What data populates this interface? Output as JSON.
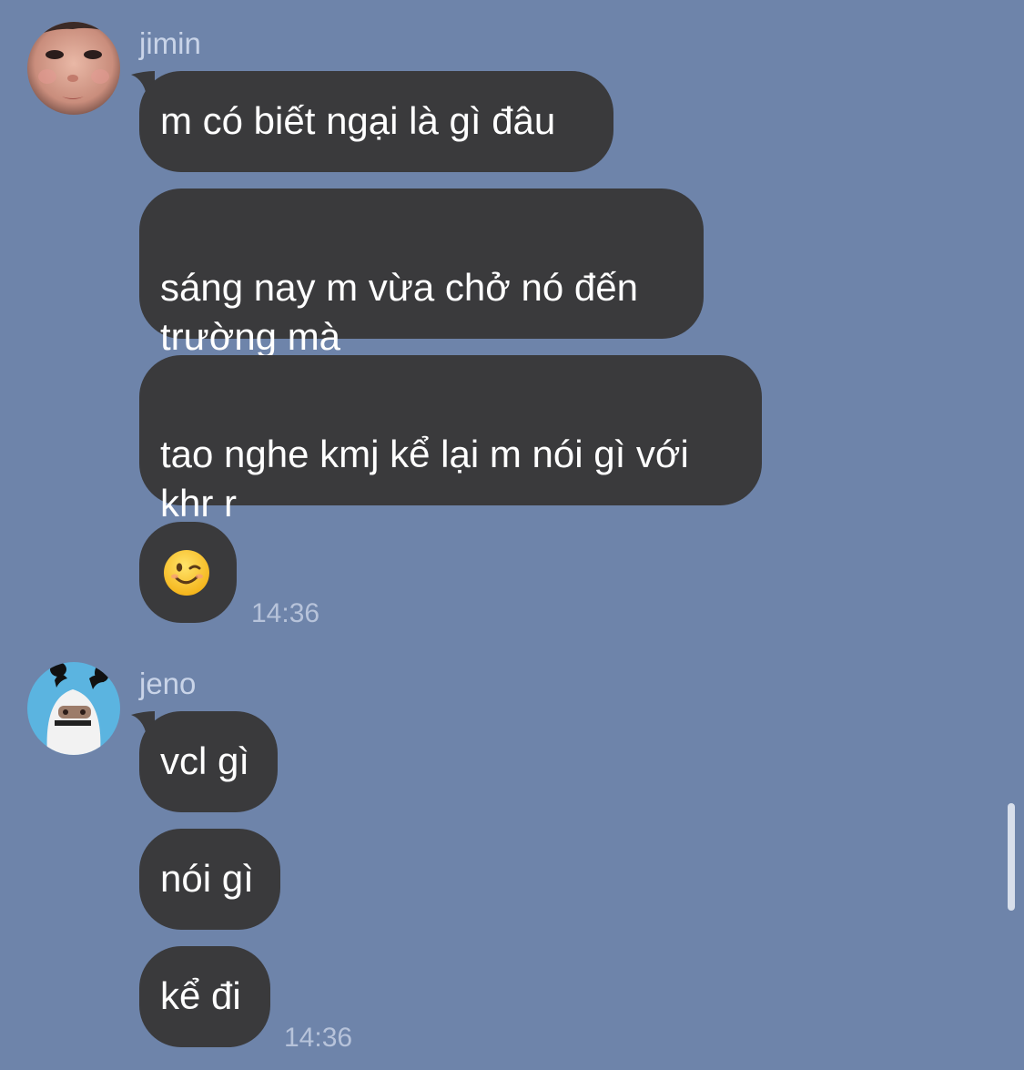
{
  "conversation": {
    "groups": [
      {
        "sender": "jimin",
        "messages": [
          "m có biết ngại là gì đâu",
          "sáng nay m vừa chở nó đến\ntrường mà",
          "tao nghe kmj kể lại m nói gì với\nkhr r"
        ],
        "emoji_message": "winking-face-emoji",
        "timestamp": "14:36"
      },
      {
        "sender": "jeno",
        "messages": [
          "vcl gì",
          "nói gì",
          "kể đi"
        ],
        "timestamp": "14:36"
      }
    ]
  },
  "colors": {
    "background": "#6e84aa",
    "bubble": "#3a3a3c",
    "bubble_text": "#ffffff",
    "meta_text": "#c9d4e8"
  }
}
